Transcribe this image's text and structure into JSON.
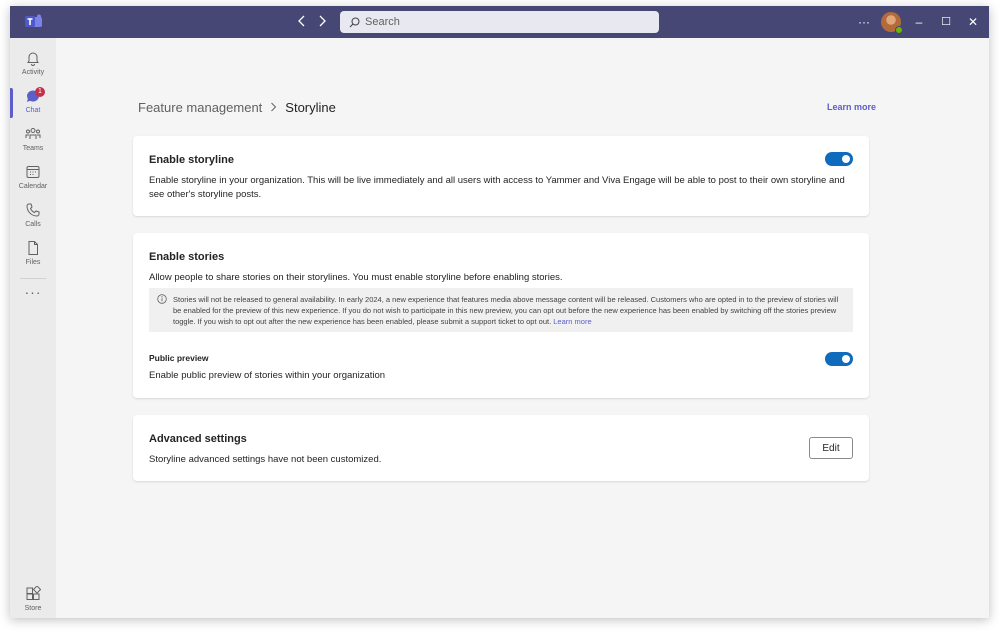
{
  "titlebar": {
    "search_placeholder": "Search",
    "back_icon": "chevron-left-icon",
    "forward_icon": "chevron-right-icon",
    "more_label": "···",
    "minimize_label": "–",
    "maximize_label": "☐",
    "close_label": "✕"
  },
  "rail": {
    "items": [
      {
        "label": "Activity",
        "icon": "bell-icon"
      },
      {
        "label": "Chat",
        "icon": "chat-icon",
        "badge": "1",
        "active": true
      },
      {
        "label": "Teams",
        "icon": "teams-icon"
      },
      {
        "label": "Calendar",
        "icon": "calendar-icon"
      },
      {
        "label": "Calls",
        "icon": "phone-icon"
      },
      {
        "label": "Files",
        "icon": "file-icon"
      }
    ],
    "more_label": "···",
    "store_label": "Store"
  },
  "breadcrumb": {
    "parent": "Feature management",
    "separator": ">",
    "current": "Storyline"
  },
  "learn_more_top": "Learn more",
  "cards": {
    "storyline": {
      "title": "Enable storyline",
      "description": "Enable storyline in your organization. This will be live immediately and all users with access to Yammer and Viva Engage will be able to post to their own storyline and see other's storyline posts.",
      "toggle_on": true
    },
    "stories": {
      "title": "Enable stories",
      "description": "Allow people to share stories on their storylines. You must enable storyline before enabling stories.",
      "notice_text": "Stories will not be released to general availability. In early 2024, a new experience that features media above message content will be released. Customers who are opted in to the preview of stories will be enabled for the preview of this new experience. If you do not wish to participate in this new preview, you can opt out before the new experience has been enabled by switching off the stories preview toggle. If you wish to opt out after the new experience has been enabled, please submit a support ticket to opt out.",
      "notice_link": "Learn more",
      "preview_title": "Public preview",
      "preview_description": "Enable public preview of stories within your organization",
      "preview_toggle_on": true
    },
    "advanced": {
      "title": "Advanced settings",
      "description": "Storyline advanced settings have not been customized.",
      "edit_label": "Edit"
    }
  },
  "colors": {
    "titlebar": "#464775",
    "accent": "#5b5fc7",
    "toggle": "#0f6cbd",
    "badge": "#c4314b"
  }
}
